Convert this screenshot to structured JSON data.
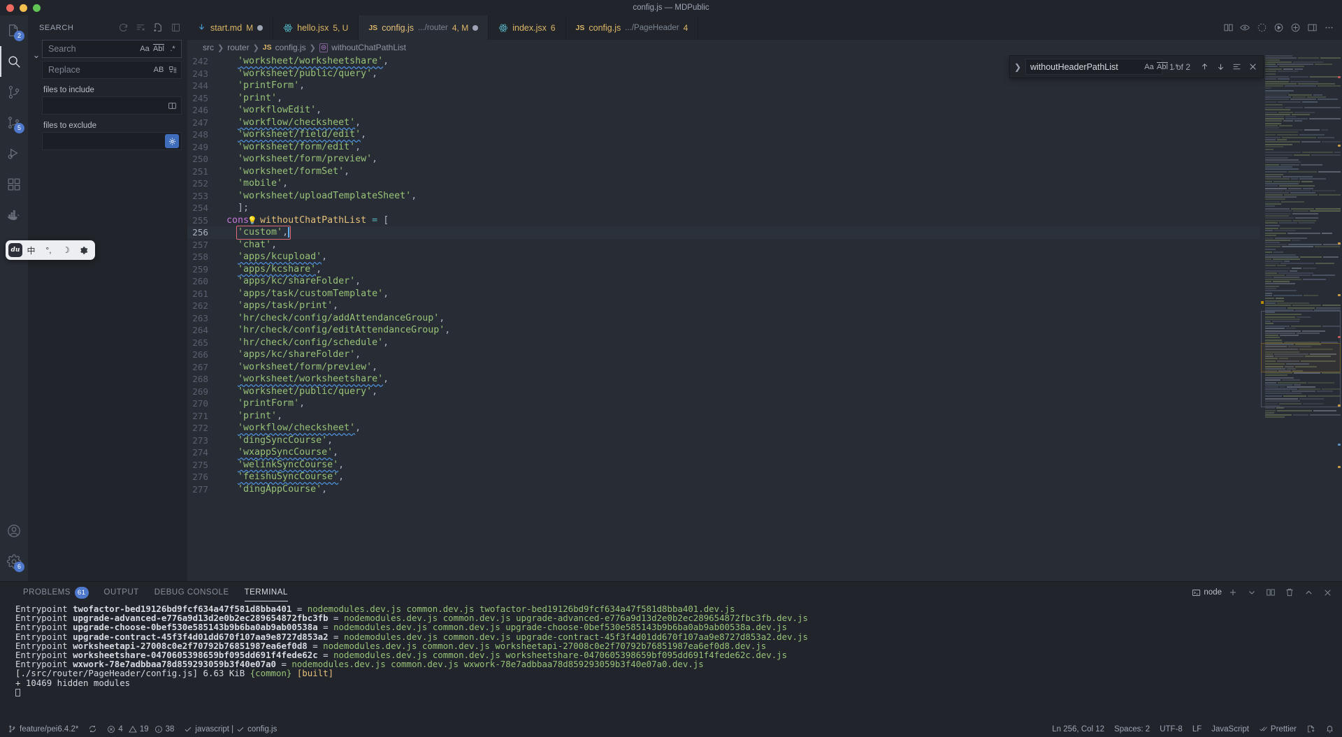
{
  "window": {
    "title": "config.js — MDPublic"
  },
  "activity_bar": {
    "items": [
      {
        "name": "explorer",
        "icon": "files-icon",
        "badge": "2",
        "active": false
      },
      {
        "name": "search",
        "icon": "search-icon",
        "badge": "",
        "active": true
      },
      {
        "name": "source-control-git",
        "icon": "git-branch-icon",
        "badge": "",
        "active": false
      },
      {
        "name": "source-control",
        "icon": "source-control-icon",
        "badge": "5",
        "active": false
      },
      {
        "name": "run-and-debug",
        "icon": "run-debug-icon",
        "badge": "",
        "active": false
      },
      {
        "name": "extensions",
        "icon": "extensions-icon",
        "badge": "",
        "active": false
      },
      {
        "name": "docker",
        "icon": "docker-icon",
        "badge": "",
        "active": false
      }
    ],
    "bottom": [
      {
        "name": "accounts",
        "icon": "account-icon",
        "badge": ""
      },
      {
        "name": "settings",
        "icon": "gear-icon",
        "badge": "6"
      }
    ]
  },
  "ime_popup": {
    "logo": "du",
    "items": [
      "中",
      "°,",
      "☽",
      "gear-icon"
    ]
  },
  "sidebar": {
    "title": "SEARCH",
    "actions": [
      "refresh-icon",
      "clear-search-results-icon",
      "open-new-search-editor-icon",
      "view-as-tree-icon"
    ],
    "search": {
      "placeholder": "Search",
      "value": ""
    },
    "search_toggles": [
      "Aa",
      "Abl",
      ".*"
    ],
    "replace": {
      "placeholder": "Replace",
      "value": ""
    },
    "replace_toggles": [
      "AB"
    ],
    "replace_actions": [
      "replace-all-icon"
    ],
    "files_to_include": {
      "label": "files to include",
      "value": "",
      "action": "use-exclude-settings-icon"
    },
    "files_to_exclude": {
      "label": "files to exclude",
      "value": "",
      "action": "use-ignore-files-icon"
    }
  },
  "tabs": [
    {
      "icon": "markdown-icon",
      "name": "start.md",
      "sub": "",
      "status": "M",
      "dirty": true,
      "active": false
    },
    {
      "icon": "react-icon",
      "name": "hello.jsx",
      "sub": "",
      "status": "5, U",
      "dirty": false,
      "active": false
    },
    {
      "icon": "js-icon",
      "name": "config.js",
      "sub": ".../router",
      "status": "4, M",
      "dirty": true,
      "active": true
    },
    {
      "icon": "react-icon",
      "name": "index.jsx",
      "sub": "",
      "status": "6",
      "dirty": false,
      "active": false
    },
    {
      "icon": "js-icon",
      "name": "config.js",
      "sub": ".../PageHeader",
      "status": "4",
      "dirty": false,
      "active": false
    }
  ],
  "tabs_right_actions": [
    "split-editor-icon",
    "toggle-inlay-icon",
    "more-actions-circle-icon",
    "run-icon",
    "open-changes-icon",
    "toggle-panel-icon",
    "ellipsis-icon"
  ],
  "breadcrumbs": [
    {
      "label": "src",
      "kind": "folder"
    },
    {
      "label": "router",
      "kind": "folder"
    },
    {
      "label": "config.js",
      "kind": "js-file"
    },
    {
      "label": "withoutChatPathList",
      "kind": "symbol-variable"
    }
  ],
  "find_widget": {
    "query": "withoutHeaderPathList",
    "toggles": [
      "Aa",
      "Abl",
      ".*"
    ],
    "match_count": "1 of 2",
    "buttons": [
      "previous-match-icon",
      "next-match-icon",
      "find-in-selection-icon",
      "close-find-icon"
    ]
  },
  "editor": {
    "cursor_line": 256,
    "lines": [
      {
        "n": 242,
        "text": "'worksheet/worksheetshare',",
        "squiggle": true
      },
      {
        "n": 243,
        "text": "'worksheet/public/query',",
        "squiggle": false
      },
      {
        "n": 244,
        "text": "'printForm',",
        "squiggle": false
      },
      {
        "n": 245,
        "text": "'print',",
        "squiggle": false
      },
      {
        "n": 246,
        "text": "'workflowEdit',",
        "squiggle": false
      },
      {
        "n": 247,
        "text": "'workflow/checksheet',",
        "squiggle": true
      },
      {
        "n": 248,
        "text": "'worksheet/field/edit',",
        "squiggle": true
      },
      {
        "n": 249,
        "text": "'worksheet/form/edit',",
        "squiggle": false
      },
      {
        "n": 250,
        "text": "'worksheet/form/preview',",
        "squiggle": false
      },
      {
        "n": 251,
        "text": "'worksheet/formSet',",
        "squiggle": false
      },
      {
        "n": 252,
        "text": "'mobile',",
        "squiggle": false
      },
      {
        "n": 253,
        "text": "'worksheet/uploadTemplateSheet',",
        "squiggle": false
      },
      {
        "n": 254,
        "text": "];",
        "squiggle": false
      },
      {
        "n": 255,
        "text": "const withoutChatPathList = [",
        "squiggle": false,
        "lightbulb": true,
        "kind": "decl"
      },
      {
        "n": 256,
        "text": "'custom',",
        "squiggle": false,
        "current": true,
        "boxed": true
      },
      {
        "n": 257,
        "text": "'chat',",
        "squiggle": false
      },
      {
        "n": 258,
        "text": "'apps/kcupload',",
        "squiggle": true
      },
      {
        "n": 259,
        "text": "'apps/kcshare',",
        "squiggle": true
      },
      {
        "n": 260,
        "text": "'apps/kc/shareFolder',",
        "squiggle": false
      },
      {
        "n": 261,
        "text": "'apps/task/customTemplate',",
        "squiggle": false
      },
      {
        "n": 262,
        "text": "'apps/task/print',",
        "squiggle": false
      },
      {
        "n": 263,
        "text": "'hr/check/config/addAttendanceGroup',",
        "squiggle": false
      },
      {
        "n": 264,
        "text": "'hr/check/config/editAttendanceGroup',",
        "squiggle": false
      },
      {
        "n": 265,
        "text": "'hr/check/config/schedule',",
        "squiggle": false
      },
      {
        "n": 266,
        "text": "'apps/kc/shareFolder',",
        "squiggle": false
      },
      {
        "n": 267,
        "text": "'worksheet/form/preview',",
        "squiggle": false
      },
      {
        "n": 268,
        "text": "'worksheet/worksheetshare',",
        "squiggle": true
      },
      {
        "n": 269,
        "text": "'worksheet/public/query',",
        "squiggle": false
      },
      {
        "n": 270,
        "text": "'printForm',",
        "squiggle": false
      },
      {
        "n": 271,
        "text": "'print',",
        "squiggle": false
      },
      {
        "n": 272,
        "text": "'workflow/checksheet',",
        "squiggle": true
      },
      {
        "n": 273,
        "text": "'dingSyncCourse',",
        "squiggle": false
      },
      {
        "n": 274,
        "text": "'wxappSyncCourse',",
        "squiggle": true
      },
      {
        "n": 275,
        "text": "'welinkSyncCourse',",
        "squiggle": true
      },
      {
        "n": 276,
        "text": "'feishuSyncCourse',",
        "squiggle": true
      },
      {
        "n": 277,
        "text": "'dingAppCourse',",
        "squiggle": false
      }
    ]
  },
  "panel": {
    "tabs": [
      {
        "label": "PROBLEMS",
        "badge": "61",
        "active": false
      },
      {
        "label": "OUTPUT",
        "badge": "",
        "active": false
      },
      {
        "label": "DEBUG CONSOLE",
        "badge": "",
        "active": false
      },
      {
        "label": "TERMINAL",
        "badge": "",
        "active": true
      }
    ],
    "terminal_name": "node",
    "right_actions": [
      "new-terminal-icon",
      "chevron-down-icon",
      "split-terminal-icon",
      "trash-icon",
      "maximize-panel-icon",
      "close-panel-icon"
    ],
    "terminal_lines": [
      {
        "pre": "Entrypoint ",
        "bold": "twofactor-bed19126bd9fcf634a47f581d8bba401",
        "eq": " = ",
        "green": "nodemodules.dev.js common.dev.js twofactor-bed19126bd9fcf634a47f581d8bba401.dev.js"
      },
      {
        "pre": "Entrypoint ",
        "bold": "upgrade-advanced-e776a9d13d2e0b2ec289654872fbc3fb",
        "eq": " = ",
        "green": "nodemodules.dev.js common.dev.js upgrade-advanced-e776a9d13d2e0b2ec289654872fbc3fb.dev.js"
      },
      {
        "pre": "Entrypoint ",
        "bold": "upgrade-choose-0bef530e585143b9b6ba0ab9ab00538a",
        "eq": " = ",
        "green": "nodemodules.dev.js common.dev.js upgrade-choose-0bef530e585143b9b6ba0ab9ab00538a.dev.js"
      },
      {
        "pre": "Entrypoint ",
        "bold": "upgrade-contract-45f3f4d01dd670f107aa9e8727d853a2",
        "eq": " = ",
        "green": "nodemodules.dev.js common.dev.js upgrade-contract-45f3f4d01dd670f107aa9e8727d853a2.dev.js"
      },
      {
        "pre": "Entrypoint ",
        "bold": "worksheetapi-27008c0e2f70792b76851987ea6ef0d8",
        "eq": " = ",
        "green": "nodemodules.dev.js common.dev.js worksheetapi-27008c0e2f70792b76851987ea6ef0d8.dev.js"
      },
      {
        "pre": "Entrypoint ",
        "bold": "worksheetshare-0470605398659bf095dd691f4fede62c",
        "eq": " = ",
        "green": "nodemodules.dev.js common.dev.js worksheetshare-0470605398659bf095dd691f4fede62c.dev.js"
      },
      {
        "pre": "Entrypoint ",
        "bold": "wxwork-78e7adbbaa78d859293059b3f40e07a0",
        "eq": " = ",
        "green": "nodemodules.dev.js common.dev.js wxwork-78e7adbbaa78d859293059b3f40e07a0.dev.js"
      }
    ],
    "built_line": {
      "path": "[./src/router/PageHeader/config.js]",
      "size": "6.63 KiB",
      "chunk": "{common}",
      "state": "[built]"
    },
    "hidden_modules": "+ 10469 hidden modules"
  },
  "status_bar": {
    "branch": "feature/pei6.4.2*",
    "sync_icon": "sync-icon",
    "errors": "4",
    "warnings": "19",
    "infos": "38",
    "eslint": "javascript | ",
    "eslint_file": "config.js",
    "position": "Ln 256, Col 12",
    "spaces": "Spaces: 2",
    "encoding": "UTF-8",
    "eol": "LF",
    "language": "JavaScript",
    "prettier": "Prettier",
    "right_icons": [
      "remote-icon",
      "notifications-bell-icon"
    ]
  }
}
